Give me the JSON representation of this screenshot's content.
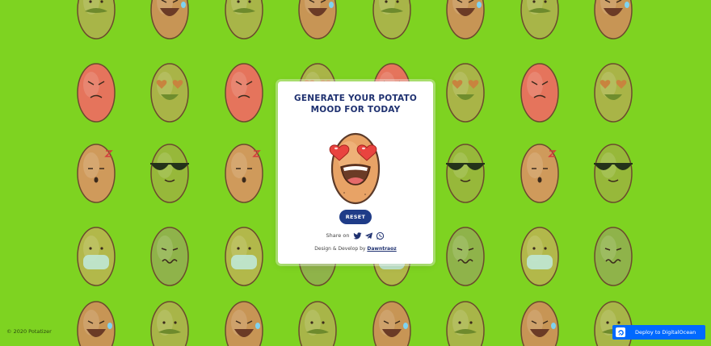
{
  "app": {
    "heading_line1": "GENERATE YOUR POTATO",
    "heading_line2": "MOOD FOR TODAY",
    "reset_label": "RESET",
    "share_label": "Share on",
    "credit_prefix": "Design & Develop by",
    "credit_author": "Dawntraoz",
    "copyright": "© 2020 Potatizer",
    "deploy_label": "Deploy to DigitalOcean"
  },
  "share_icons": [
    "twitter-icon",
    "telegram-icon",
    "whatsapp-icon"
  ],
  "colors": {
    "background": "#7ed321",
    "accent": "#1f3c88",
    "deploy": "#0069ff"
  },
  "background_moods": [
    "mustache",
    "laughing",
    "heart-eyes",
    "angry",
    "sleeping",
    "sunglasses",
    "sick",
    "mask"
  ]
}
